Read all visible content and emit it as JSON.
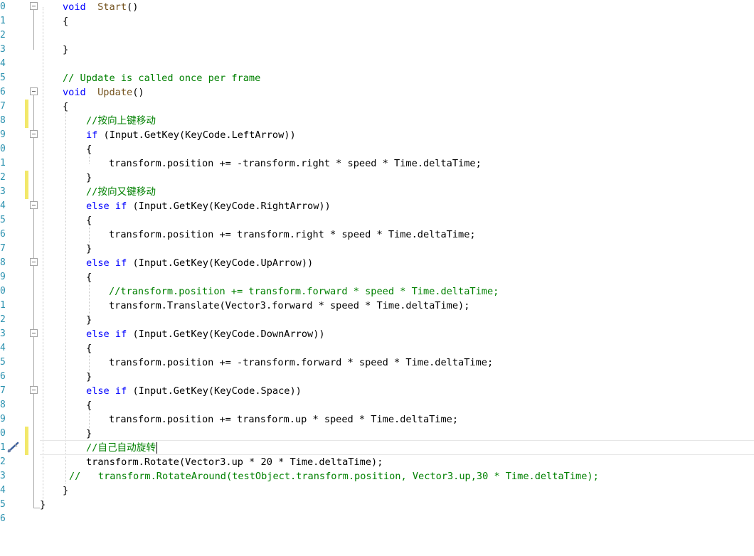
{
  "editor": {
    "lines": [
      {
        "n": "0",
        "fold": true,
        "indent": 88,
        "tokens": [
          [
            "kw",
            "void"
          ],
          [
            "",
            "  "
          ],
          [
            "fn",
            "Start"
          ],
          [
            "",
            "()"
          ]
        ]
      },
      {
        "n": "1",
        "indent": 88,
        "tokens": [
          [
            "",
            "{"
          ]
        ]
      },
      {
        "n": "2",
        "indent": 88,
        "tokens": []
      },
      {
        "n": "3",
        "indent": 88,
        "tokens": [
          [
            "",
            "}"
          ]
        ]
      },
      {
        "n": "4",
        "indent": 88,
        "tokens": []
      },
      {
        "n": "5",
        "indent": 88,
        "tokens": [
          [
            "cm",
            "// Update is called once per frame"
          ]
        ]
      },
      {
        "n": "6",
        "fold": true,
        "indent": 88,
        "tokens": [
          [
            "kw",
            "void"
          ],
          [
            "",
            "  "
          ],
          [
            "fn",
            "Update"
          ],
          [
            "",
            "()"
          ]
        ]
      },
      {
        "n": "7",
        "changed": true,
        "indent": 88,
        "tokens": [
          [
            "",
            "{"
          ]
        ]
      },
      {
        "n": "8",
        "changed": true,
        "indent": 121,
        "tokens": [
          [
            "cm",
            "//按向上键移动"
          ]
        ]
      },
      {
        "n": "9",
        "fold": true,
        "indent": 121,
        "tokens": [
          [
            "kw",
            "if"
          ],
          [
            "",
            " (Input.GetKey(KeyCode.LeftArrow))"
          ]
        ]
      },
      {
        "n": "0",
        "indent": 121,
        "tokens": [
          [
            "",
            "{"
          ]
        ]
      },
      {
        "n": "1",
        "indent": 153,
        "tokens": [
          [
            "",
            "transform.position += -transform.right * speed * Time.deltaTime;"
          ]
        ]
      },
      {
        "n": "2",
        "changed": true,
        "indent": 121,
        "tokens": [
          [
            "",
            "}"
          ]
        ]
      },
      {
        "n": "3",
        "changed": true,
        "indent": 121,
        "tokens": [
          [
            "cm",
            "//按向又键移动"
          ]
        ]
      },
      {
        "n": "4",
        "fold": true,
        "indent": 121,
        "tokens": [
          [
            "kw",
            "else if"
          ],
          [
            "",
            " (Input.GetKey(KeyCode.RightArrow))"
          ]
        ]
      },
      {
        "n": "5",
        "indent": 121,
        "tokens": [
          [
            "",
            "{"
          ]
        ]
      },
      {
        "n": "6",
        "indent": 153,
        "tokens": [
          [
            "",
            "transform.position += transform.right * speed * Time.deltaTime;"
          ]
        ]
      },
      {
        "n": "7",
        "indent": 121,
        "tokens": [
          [
            "",
            "}"
          ]
        ]
      },
      {
        "n": "8",
        "fold": true,
        "indent": 121,
        "tokens": [
          [
            "kw",
            "else if"
          ],
          [
            "",
            " (Input.GetKey(KeyCode.UpArrow))"
          ]
        ]
      },
      {
        "n": "9",
        "indent": 121,
        "tokens": [
          [
            "",
            "{"
          ]
        ]
      },
      {
        "n": "0",
        "indent": 153,
        "tokens": [
          [
            "cm",
            "//transform.position += transform.forward * speed * Time.deltaTime;"
          ]
        ]
      },
      {
        "n": "1",
        "indent": 153,
        "tokens": [
          [
            "",
            "transform.Translate(Vector3.forward * speed * Time.deltaTime);"
          ]
        ]
      },
      {
        "n": "2",
        "indent": 121,
        "tokens": [
          [
            "",
            "}"
          ]
        ]
      },
      {
        "n": "3",
        "fold": true,
        "indent": 121,
        "tokens": [
          [
            "kw",
            "else if"
          ],
          [
            "",
            " (Input.GetKey(KeyCode.DownArrow))"
          ]
        ]
      },
      {
        "n": "4",
        "indent": 121,
        "tokens": [
          [
            "",
            "{"
          ]
        ]
      },
      {
        "n": "5",
        "indent": 153,
        "tokens": [
          [
            "",
            "transform.position += -transform.forward * speed * Time.deltaTime;"
          ]
        ]
      },
      {
        "n": "6",
        "indent": 121,
        "tokens": [
          [
            "",
            "}"
          ]
        ]
      },
      {
        "n": "7",
        "fold": true,
        "indent": 121,
        "tokens": [
          [
            "kw",
            "else if"
          ],
          [
            "",
            " (Input.GetKey(KeyCode.Space))"
          ]
        ]
      },
      {
        "n": "8",
        "indent": 121,
        "tokens": [
          [
            "",
            "{"
          ]
        ]
      },
      {
        "n": "9",
        "indent": 153,
        "tokens": [
          [
            "",
            "transform.position += transform.up * speed * Time.deltaTime;"
          ]
        ]
      },
      {
        "n": "0",
        "changed": true,
        "indent": 121,
        "tokens": [
          [
            "",
            "}"
          ]
        ]
      },
      {
        "n": "1",
        "changed": true,
        "current": true,
        "indent": 121,
        "tokens": [
          [
            "cm",
            "//自己自动旋转"
          ]
        ]
      },
      {
        "n": "2",
        "indent": 121,
        "tokens": [
          [
            "",
            "transform.Rotate(Vector3.up * 20 * Time.deltaTime);"
          ]
        ]
      },
      {
        "n": "3",
        "indent": 97,
        "tokens": [
          [
            "cm",
            "//   transform.RotateAround(testObject.transform.position, Vector3.up,30 * Time.deltaTime);"
          ]
        ]
      },
      {
        "n": "4",
        "indent": 88,
        "tokens": [
          [
            "",
            "}"
          ]
        ]
      },
      {
        "n": "5",
        "indent": 56,
        "tokens": [
          [
            "",
            "}"
          ]
        ]
      },
      {
        "n": "6",
        "indent": 56,
        "tokens": []
      }
    ],
    "colors": {
      "keyword": "#0000ff",
      "method": "#74531f",
      "comment": "#008000",
      "line_number": "#2b91af",
      "change_marker": "#f2e86a"
    },
    "icons": {
      "gutter": "brush-icon",
      "fold": "collapse-minus-icon"
    }
  }
}
